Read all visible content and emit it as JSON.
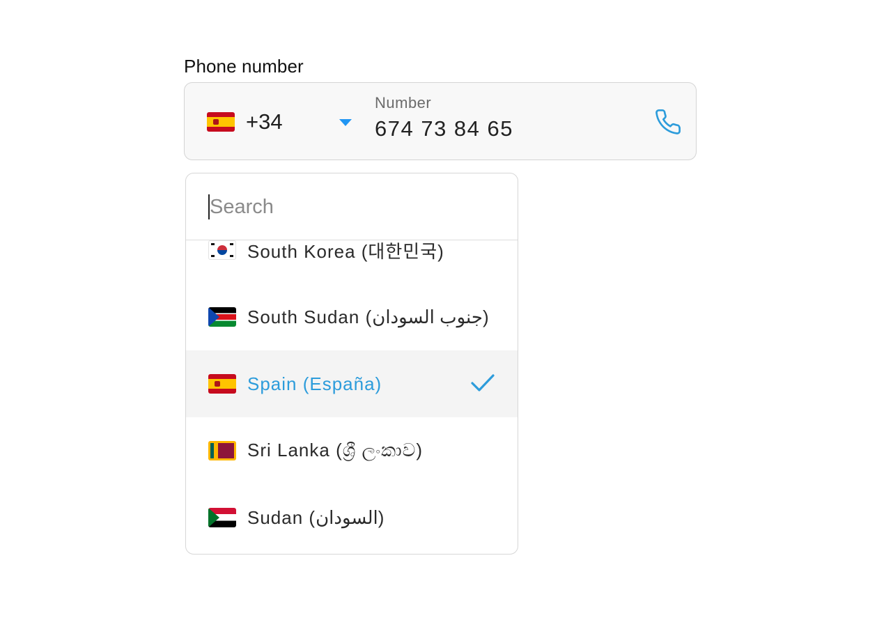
{
  "field": {
    "label": "Phone number"
  },
  "country_select": {
    "flag": "spain-flag-icon",
    "dial_code": "+34",
    "caret_icon": "triangle-down-icon"
  },
  "number_input": {
    "label": "Number",
    "value": "674 73 84 65",
    "action_icon": "phone-icon"
  },
  "dropdown": {
    "search": {
      "placeholder": "Search",
      "value": ""
    },
    "items": [
      {
        "label": "South Korea (대한민국)",
        "flag": "south-korea-flag-icon",
        "selected": false
      },
      {
        "label": "South Sudan (جنوب السودان)",
        "flag": "south-sudan-flag-icon",
        "selected": false
      },
      {
        "label": "Spain (España)",
        "flag": "spain-flag-icon",
        "selected": true
      },
      {
        "label": "Sri Lanka (ශ්‍රී ලංකාව)",
        "flag": "sri-lanka-flag-icon",
        "selected": false
      },
      {
        "label": "Sudan (السودان)",
        "flag": "sudan-flag-icon",
        "selected": false
      }
    ]
  },
  "colors": {
    "accent": "#2d9cdb",
    "field_background": "#f8f8f8",
    "border": "#d4d4d4",
    "selected_row": "#f4f4f4"
  }
}
